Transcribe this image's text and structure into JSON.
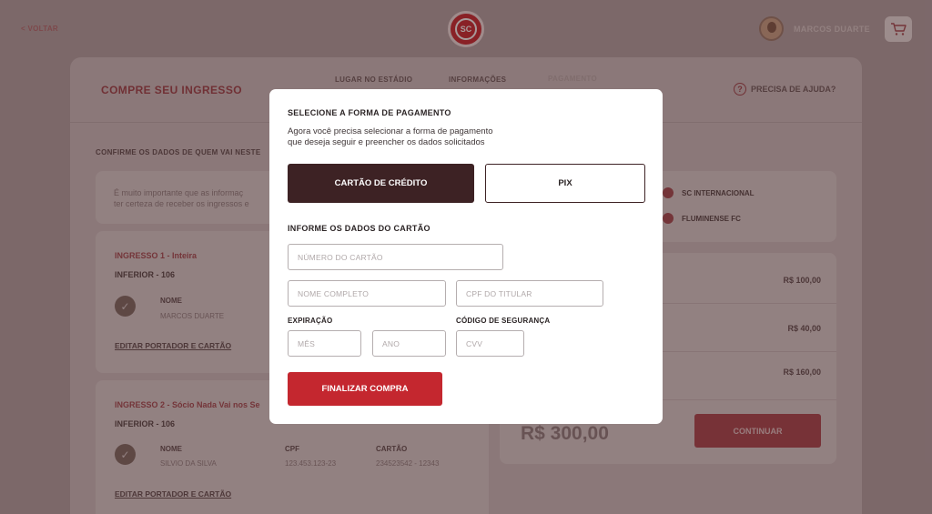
{
  "header": {
    "back_label": "< VOLTAR",
    "user_name": "MARCOS DUARTE",
    "logo_icon": "internacional-crest-icon",
    "cart_icon": "shopping-cart-icon"
  },
  "panel": {
    "title": "COMPRE SEU INGRESSO",
    "steps": [
      "LUGAR NO ESTÁDIO",
      "INFORMAÇÕES",
      "PAGAMENTO"
    ],
    "help_label": "PRECISA DE AJUDA?",
    "confirm_title": "CONFIRME OS DADOS DE QUEM VAI NESTE",
    "notice_text_line1": "É muito importante que as informaç",
    "notice_text_line2": "ter certeza de receber os ingressos e"
  },
  "tickets": [
    {
      "title": "INGRESSO 1 - Inteira",
      "sector": "INFERIOR - 106",
      "name_label": "NOME",
      "name_value": "MARCOS DUARTE",
      "edit_label": "EDITAR PORTADOR E CARTÃO"
    },
    {
      "title": "INGRESSO 2 - Sócio Nada Vai nos Se",
      "sector": "INFERIOR - 106",
      "name_label": "NOME",
      "name_value": "SILVIO DA SILVA",
      "cpf_label": "CPF",
      "cpf_value": "123.453.123-23",
      "card_label": "CARTÃO",
      "card_value": "234523542 - 12343",
      "edit_label": "EDITAR PORTADOR E CARTÃO"
    }
  ],
  "match": {
    "home": "SC INTERNACIONAL",
    "away": "FLUMINENSE FC"
  },
  "summary": {
    "prices": [
      "R$ 100,00",
      "R$ 40,00",
      "R$ 160,00"
    ],
    "total": "R$ 300,00",
    "continue_label": "CONTINUAR"
  },
  "modal": {
    "title": "SELECIONE A FORMA DE PAGAMENTO",
    "desc_line1": "Agora você precisa selecionar a forma de pagamento",
    "desc_line2": "que deseja seguir e preencher os dados solicitados",
    "method_card": "CARTÃO DE CRÉDITO",
    "method_pix": "PIX",
    "section_title": "INFORME OS DADOS DO CARTÃO",
    "placeholders": {
      "card_number": "NÚMERO DO CARTÃO",
      "full_name": "NOME COMPLETO",
      "cpf": "CPF DO TITULAR",
      "month": "MÊS",
      "year": "ANO",
      "cvv": "CVV"
    },
    "expiration_label": "EXPIRAÇÃO",
    "security_label": "CÓDIGO DE SEGURANÇA",
    "finish_label": "FINALIZAR COMPRA"
  }
}
